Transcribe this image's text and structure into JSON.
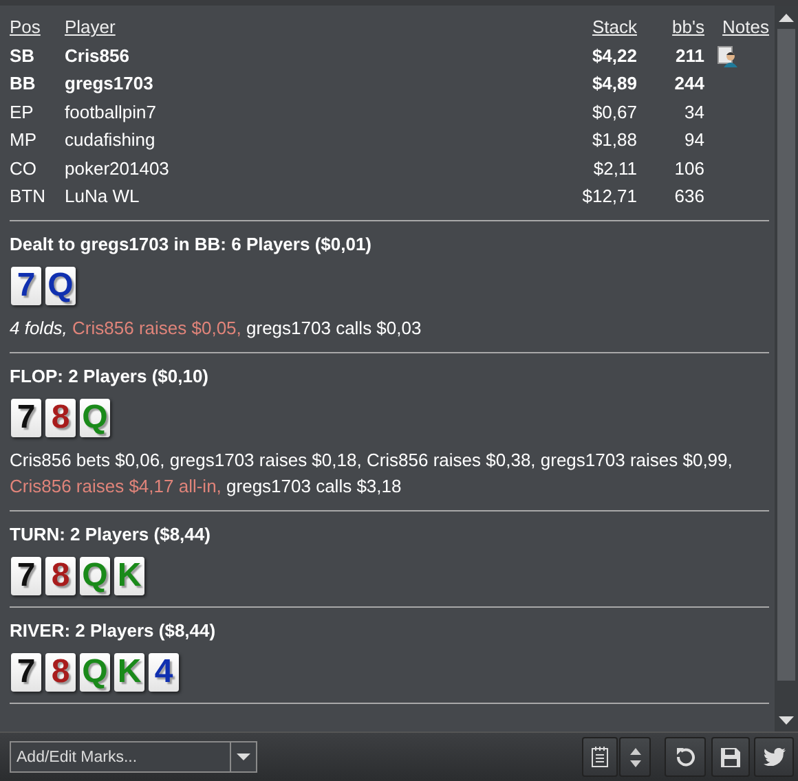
{
  "players": {
    "columns": [
      "Pos",
      "Player",
      "Stack",
      "bb's",
      "Notes"
    ],
    "rows": [
      {
        "pos": "SB",
        "player": "Cris856",
        "stack": "$4,22",
        "bbs": "211",
        "highlighted": true,
        "note": true
      },
      {
        "pos": "BB",
        "player": "gregs1703",
        "stack": "$4,89",
        "bbs": "244",
        "highlighted": true,
        "note": false
      },
      {
        "pos": "EP",
        "player": "footballpin7",
        "stack": "$0,67",
        "bbs": "34",
        "highlighted": false,
        "note": false
      },
      {
        "pos": "MP",
        "player": "cudafishing",
        "stack": "$1,88",
        "bbs": "94",
        "highlighted": false,
        "note": false
      },
      {
        "pos": "CO",
        "player": "poker201403",
        "stack": "$2,11",
        "bbs": "106",
        "highlighted": false,
        "note": false
      },
      {
        "pos": "BTN",
        "player": "LuNa WL",
        "stack": "$12,71",
        "bbs": "636",
        "highlighted": false,
        "note": false
      }
    ]
  },
  "streets": [
    {
      "title": "Dealt to gregs1703 in BB: 6 Players ($0,01)",
      "cards": [
        {
          "rank": "7",
          "color": "#1030b0"
        },
        {
          "rank": "Q",
          "color": "#1030b0"
        }
      ],
      "actions": [
        {
          "kind": "fold",
          "text": "4 folds,"
        },
        {
          "kind": "aggressor",
          "text": "Cris856 raises $0,05,"
        },
        {
          "kind": "normal",
          "text": "gregs1703 calls $0,03"
        }
      ]
    },
    {
      "title": "FLOP: 2 Players ($0,10)",
      "cards": [
        {
          "rank": "7",
          "color": "#111111"
        },
        {
          "rank": "8",
          "color": "#a81c1c"
        },
        {
          "rank": "Q",
          "color": "#1a8a1a"
        }
      ],
      "actions": [
        {
          "kind": "normal",
          "text": "Cris856 bets $0,06, gregs1703 raises $0,18, Cris856 raises $0,38, gregs1703 raises $0,99,"
        },
        {
          "kind": "aggressor",
          "text": "Cris856 raises $4,17 all-in,"
        },
        {
          "kind": "normal",
          "text": "gregs1703 calls $3,18"
        }
      ]
    },
    {
      "title": "TURN: 2 Players ($8,44)",
      "cards": [
        {
          "rank": "7",
          "color": "#111111"
        },
        {
          "rank": "8",
          "color": "#a81c1c"
        },
        {
          "rank": "Q",
          "color": "#1a8a1a"
        },
        {
          "rank": "K",
          "color": "#1a8a1a"
        }
      ]
    },
    {
      "title": "RIVER: 2 Players ($8,44)",
      "cards": [
        {
          "rank": "7",
          "color": "#111111"
        },
        {
          "rank": "8",
          "color": "#a81c1c"
        },
        {
          "rank": "Q",
          "color": "#1a8a1a"
        },
        {
          "rank": "K",
          "color": "#1a8a1a"
        },
        {
          "rank": "4",
          "color": "#1030b0"
        }
      ]
    }
  ],
  "toolbar": {
    "marks_placeholder": "Add/Edit Marks..."
  }
}
